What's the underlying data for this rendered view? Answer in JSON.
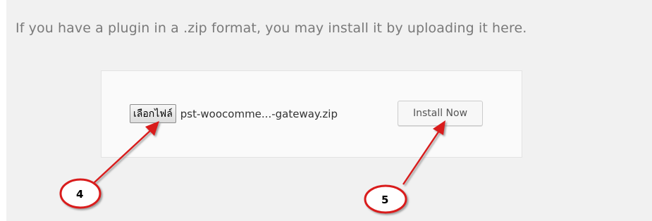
{
  "upload": {
    "help_text": "If you have a plugin in a .zip format, you may install it by uploading it here.",
    "choose_file_label": "เลือกไฟล์",
    "file_name": "pst-woocomme...-gateway.zip",
    "install_label": "Install Now"
  },
  "annotations": {
    "step_4": "4",
    "step_5": "5"
  },
  "colors": {
    "background": "#f1f1f1",
    "annotation": "#d91b1b"
  }
}
